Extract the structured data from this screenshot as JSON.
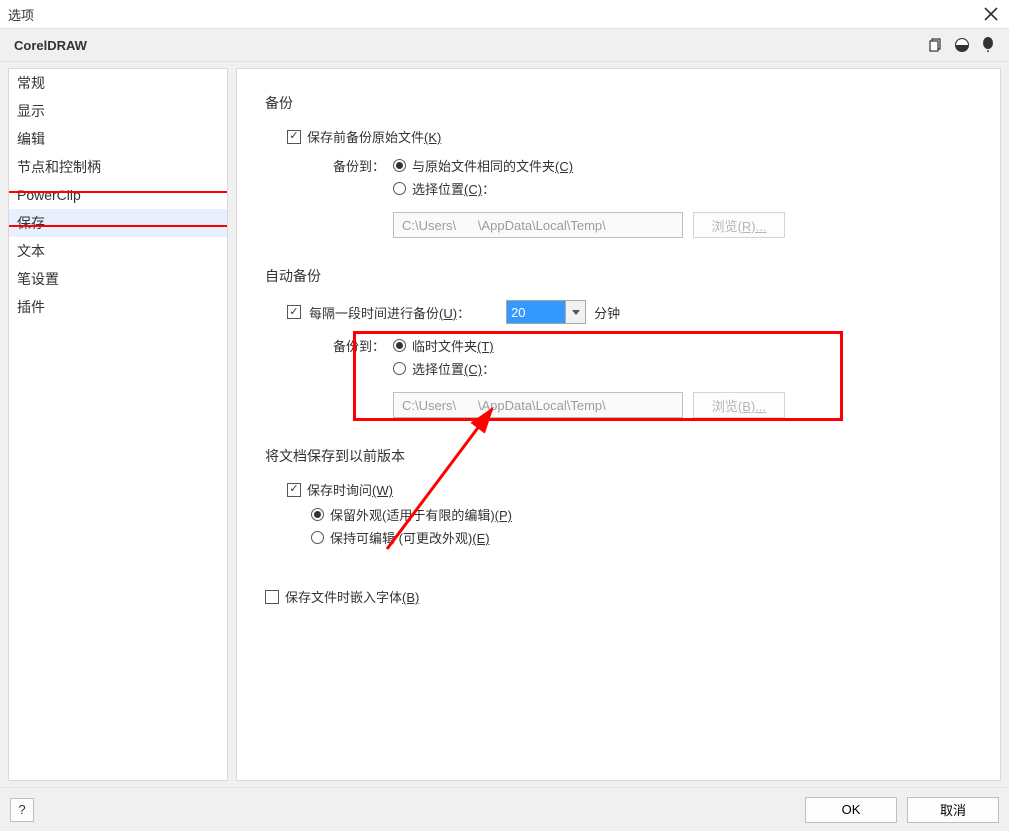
{
  "window": {
    "title": "选项"
  },
  "header": {
    "app": "CorelDRAW"
  },
  "sidebar": {
    "items": [
      {
        "label": "常规"
      },
      {
        "label": "显示"
      },
      {
        "label": "编辑"
      },
      {
        "label": "节点和控制柄"
      },
      {
        "label": "PowerClip"
      },
      {
        "label": "保存",
        "selected": true
      },
      {
        "label": "文本"
      },
      {
        "label": "笔设置"
      },
      {
        "label": "插件"
      }
    ]
  },
  "backup": {
    "title": "备份",
    "make_backup": "保存前备份原始文件",
    "make_backup_key": "(K)",
    "backup_to": "备份到：",
    "same_folder": "与原始文件相同的文件夹",
    "same_folder_key": "(C)",
    "choose_loc": "选择位置",
    "choose_loc_key": "(C)",
    "colon": "：",
    "path_pre": "C:\\Users\\",
    "path_post": "\\AppData\\Local\\Temp\\",
    "browse": "浏览",
    "browse_key": "(R)...",
    "radio_selected": "same_folder"
  },
  "autobackup": {
    "title": "自动备份",
    "every": "每隔一段时间进行备份",
    "every_key": "(U)",
    "colon": "：",
    "minutes_value": "20",
    "minutes_label": "分钟",
    "backup_to": "备份到：",
    "temp_folder": "临时文件夹",
    "temp_folder_key": "(T)",
    "choose_loc": "选择位置",
    "choose_loc_key": "(C)",
    "path_pre": "C:\\Users\\",
    "path_post": "\\AppData\\Local\\Temp\\",
    "browse": "浏览",
    "browse_key": "(B)...",
    "radio_selected": "temp_folder"
  },
  "version": {
    "title": "将文档保存到以前版本",
    "ask": "保存时询问",
    "ask_key": "(W)",
    "keep_appearance": "保留外观(适用于有限的编辑)",
    "keep_appearance_key": "(P)",
    "keep_editable": "保持可编辑 (可更改外观)",
    "keep_editable_key": "(E)",
    "radio_selected": "appearance"
  },
  "embed": {
    "label": "保存文件时嵌入字体",
    "key": "(B)",
    "checked": false
  },
  "footer": {
    "help": "?",
    "ok": "OK",
    "cancel": "取消"
  }
}
